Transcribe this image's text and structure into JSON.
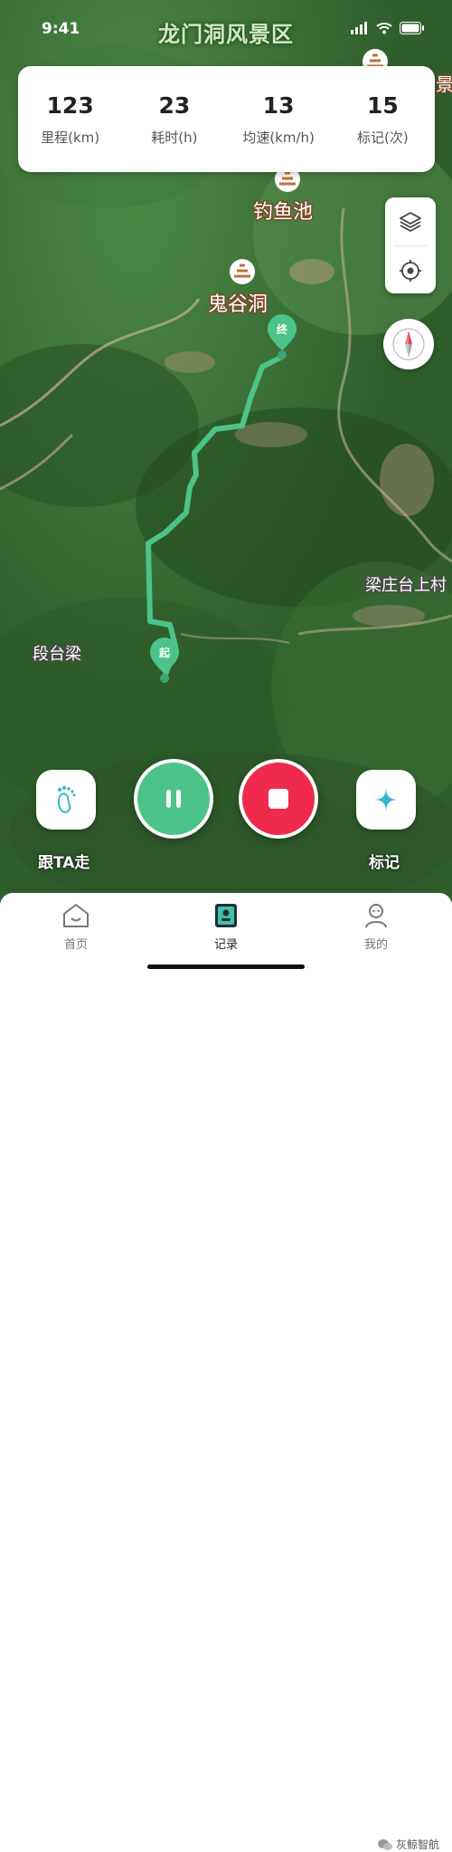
{
  "status_bar": {
    "time": "9:41",
    "map_title": "龙门洞风景区"
  },
  "stats": [
    {
      "value": "123",
      "label": "里程(km)"
    },
    {
      "value": "23",
      "label": "耗时(h)"
    },
    {
      "value": "13",
      "label": "均速(km/h)"
    },
    {
      "value": "15",
      "label": "标记(次)"
    }
  ],
  "map": {
    "poi_labels": [
      "钓鱼池",
      "鬼谷洞",
      "梁庄台上村",
      "段台梁",
      "景"
    ],
    "start_marker": "起",
    "end_marker": "终",
    "route_color": "#4cc38a"
  },
  "controls": {
    "layers_icon": "layers-icon",
    "locate_icon": "locate-icon",
    "compass_icon": "compass-icon"
  },
  "actions": {
    "follow_label": "跟TA走",
    "mark_label": "标记"
  },
  "tabs": [
    {
      "label": "首页",
      "icon": "home-icon"
    },
    {
      "label": "记录",
      "icon": "record-icon",
      "active": true
    },
    {
      "label": "我的",
      "icon": "profile-icon"
    }
  ],
  "watermark": "灰鲸智航",
  "colors": {
    "accent": "#4cc38a",
    "stop": "#ef2a4d"
  }
}
